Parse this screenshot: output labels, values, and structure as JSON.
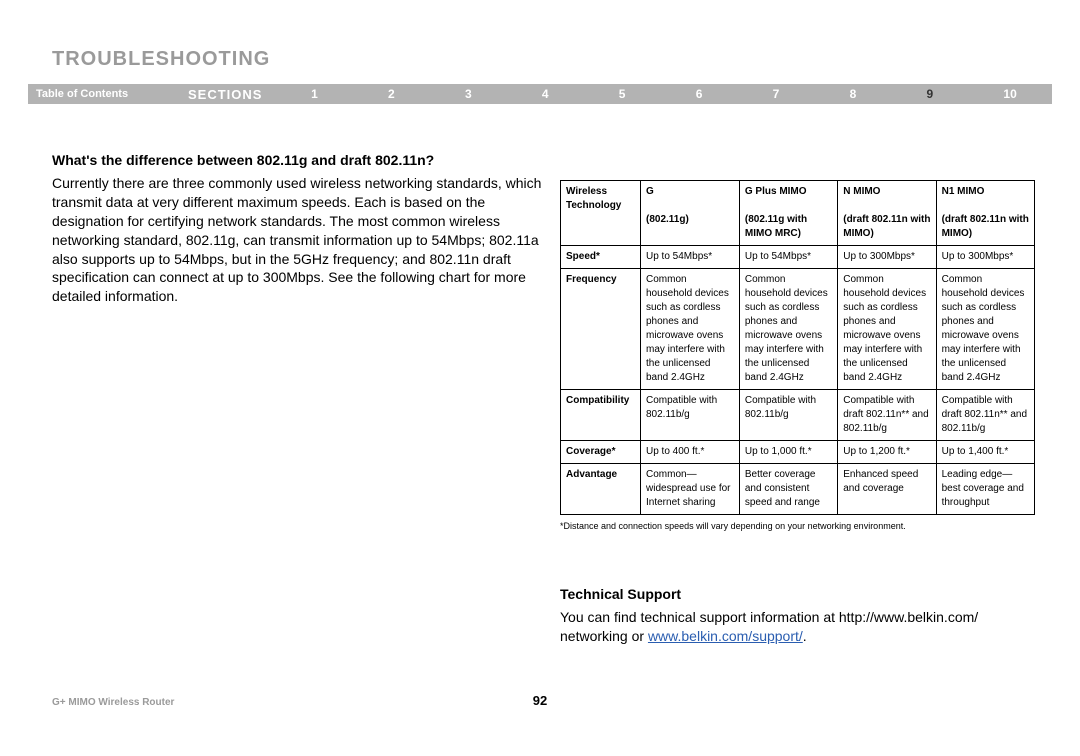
{
  "pageTitle": "TROUBLESHOOTING",
  "nav": {
    "toc": "Table of Contents",
    "sectionsLabel": "SECTIONS",
    "links": [
      "1",
      "2",
      "3",
      "4",
      "5",
      "6",
      "7",
      "8",
      "9",
      "10"
    ],
    "activeIndex": 8
  },
  "left": {
    "heading": "What's the difference between 802.11g and draft 802.11n?",
    "para": "Currently there are three commonly used wireless networking standards, which transmit data at very different maximum speeds. Each is based on the designation for certifying network standards. The most common wireless networking standard, 802.11g, can transmit information up to 54Mbps; 802.11a also supports up to 54Mbps, but in the 5GHz frequency; and 802.11n draft specification can connect at up to 300Mbps. See the following chart for more detailed information."
  },
  "table": {
    "headers": {
      "tech": "Wireless Technology",
      "g_line1": "G",
      "g_line2": "(802.11g)",
      "gplus_line1": "G Plus MIMO",
      "gplus_line2": "(802.11g with MIMO MRC)",
      "nmimo_line1": "N MIMO",
      "nmimo_line2": "(draft 802.11n with  MIMO)",
      "n1mimo_line1": "N1 MIMO",
      "n1mimo_line2": "(draft 802.11n with  MIMO)"
    },
    "rows": {
      "speed": {
        "label": "Speed*",
        "g": "Up to 54Mbps*",
        "gplus": "Up to 54Mbps*",
        "nmimo": "Up to 300Mbps*",
        "n1mimo": "Up to 300Mbps*"
      },
      "frequency": {
        "label": "Frequency",
        "g": "Common household devices such as cordless phones and microwave ovens may interfere with the unlicensed band 2.4GHz",
        "gplus": "Common household devices such as cordless phones and microwave ovens may interfere with the unlicensed band 2.4GHz",
        "nmimo": "Common household devices such as cordless phones and microwave ovens may interfere with the unlicensed band 2.4GHz",
        "n1mimo": "Common household devices such as cordless phones and microwave ovens may interfere with the unlicensed band 2.4GHz"
      },
      "compat": {
        "label": "Compatibility",
        "g": "Compatible with 802.11b/g",
        "gplus": "Compatible with 802.11b/g",
        "nmimo": "Compatible with draft 802.11n** and 802.11b/g",
        "n1mimo": "Compatible with draft 802.11n** and 802.11b/g"
      },
      "coverage": {
        "label": "Coverage*",
        "g": "Up to 400 ft.*",
        "gplus": "Up to 1,000 ft.*",
        "nmimo": "Up to 1,200 ft.*",
        "n1mimo": "Up to 1,400 ft.*"
      },
      "advantage": {
        "label": "Advantage",
        "g": "Common—widespread use for Internet sharing",
        "gplus": "Better coverage and consistent speed and range",
        "nmimo": "Enhanced speed and coverage",
        "n1mimo": "Leading edge—best coverage and throughput"
      }
    },
    "footnote": "*Distance and connection speeds will vary depending on your networking environment."
  },
  "techSupport": {
    "heading": "Technical Support",
    "text1": "You can find technical support information at http://www.belkin.com/",
    "text2": "networking or ",
    "link": "www.belkin.com/support/",
    "text3": "."
  },
  "footer": {
    "left": "G+ MIMO Wireless Router",
    "page": "92"
  }
}
